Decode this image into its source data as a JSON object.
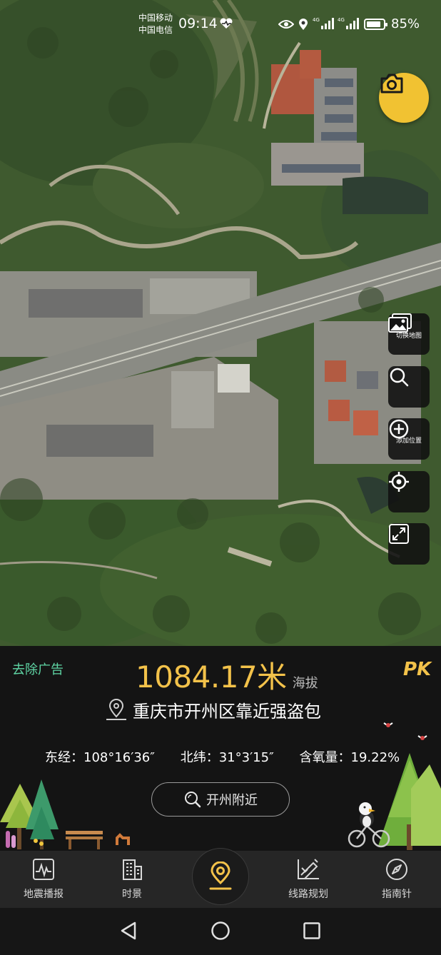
{
  "status_bar": {
    "carrier_1": "中国移动",
    "carrier_2": "中国电信",
    "time": "09:14",
    "battery_percent": "85%",
    "battery_level": 0.85,
    "icons": [
      "heart-rate-icon",
      "eye-icon",
      "location-pin-icon",
      "signal-4g-icon",
      "signal-4g-icon",
      "battery-icon"
    ]
  },
  "map": {
    "camera_button": "camera-icon",
    "tools": [
      {
        "icon": "switch-map-icon",
        "label": "切换地图"
      },
      {
        "icon": "search-icon",
        "label": ""
      },
      {
        "icon": "add-location-icon",
        "label": "添加位置"
      },
      {
        "icon": "locate-icon",
        "label": ""
      },
      {
        "icon": "expand-icon",
        "label": ""
      }
    ]
  },
  "panel": {
    "remove_ad": "去除广告",
    "altitude_value": "1084.17米",
    "altitude_unit": "海拔",
    "pk_label": "PK",
    "location": "重庆市开州区靠近强盗包",
    "longitude": "东经：108°16′36″",
    "latitude": "北纬：31°3′15″",
    "oxygen": "含氧量：19.22%",
    "nearby_button": "开州附近"
  },
  "tabbar": {
    "tabs": [
      {
        "label": "地震播报",
        "icon": "earthquake-icon"
      },
      {
        "label": "时景",
        "icon": "building-icon"
      },
      {
        "label": "",
        "icon": "location-center-icon"
      },
      {
        "label": "线路规划",
        "icon": "route-plan-icon"
      },
      {
        "label": "指南针",
        "icon": "compass-icon"
      }
    ]
  },
  "navbar": {
    "buttons": [
      "back-icon",
      "home-icon",
      "recents-icon"
    ]
  },
  "colors": {
    "accent_gold": "#f3c24a",
    "ad_green": "#5fd6a5",
    "camera_yellow": "#f1c232"
  }
}
